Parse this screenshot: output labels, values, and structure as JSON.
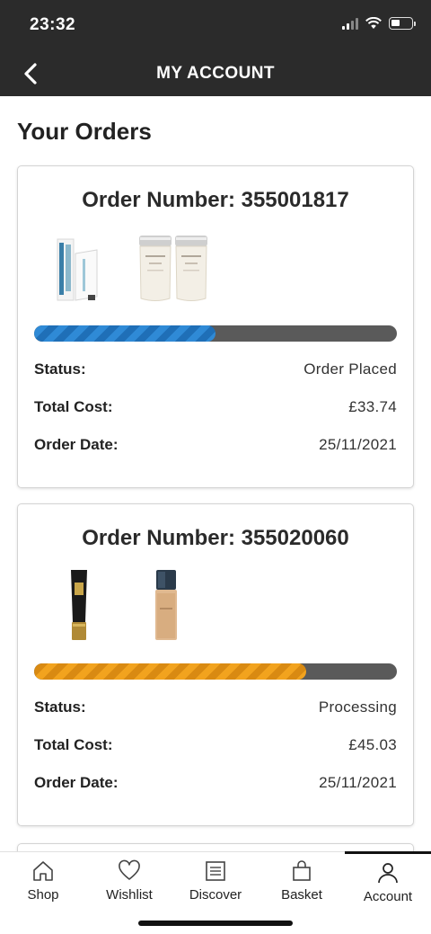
{
  "status_bar": {
    "time": "23:32"
  },
  "header": {
    "title": "MY ACCOUNT"
  },
  "page": {
    "title": "Your Orders"
  },
  "orders": [
    {
      "number_label": "Order Number: 355001817",
      "progress": 0.5,
      "progress_color": "#2f8ad6",
      "status_label": "Status:",
      "status": "Order Placed",
      "total_label": "Total Cost:",
      "total": "£33.74",
      "date_label": "Order Date:",
      "date": "25/11/2021",
      "products": [
        "eye-cream-box-product",
        "kerastase-shampoo-product",
        "kerastase-shampoo-product"
      ]
    },
    {
      "number_label": "Order Number: 355020060",
      "progress": 0.75,
      "progress_color": "#f2a31e",
      "status_label": "Status:",
      "status": "Processing",
      "total_label": "Total Cost:",
      "total": "£45.03",
      "date_label": "Order Date:",
      "date": "25/11/2021",
      "products": [
        "ysl-tube-product",
        "foundation-bottle-product"
      ]
    }
  ],
  "tabbar": {
    "items": [
      {
        "label": "Shop",
        "icon": "home-icon"
      },
      {
        "label": "Wishlist",
        "icon": "heart-icon"
      },
      {
        "label": "Discover",
        "icon": "document-icon"
      },
      {
        "label": "Basket",
        "icon": "bag-icon"
      },
      {
        "label": "Account",
        "icon": "person-icon",
        "active": true
      }
    ]
  }
}
